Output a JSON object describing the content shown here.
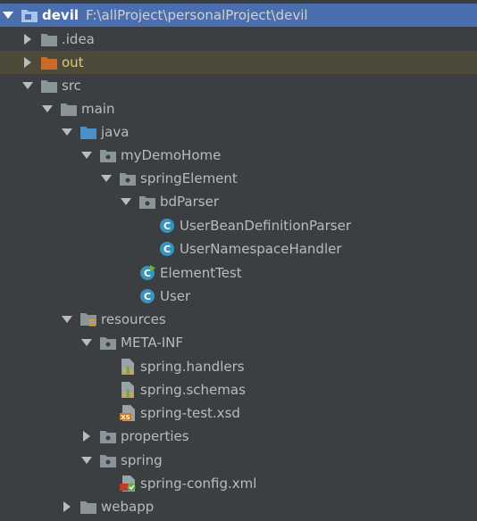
{
  "project": {
    "name": "devil",
    "path": "F:\\allProject\\personalProject\\devil"
  },
  "nodes": {
    "idea": ".idea",
    "out": "out",
    "src": "src",
    "main": "main",
    "java": "java",
    "mydemohome": "myDemoHome",
    "springelement": "springElement",
    "bdparser": "bdParser",
    "userbeandef": "UserBeanDefinitionParser",
    "usernamespace": "UserNamespaceHandler",
    "elementtest": "ElementTest",
    "user": "User",
    "resources": "resources",
    "metainf": "META-INF",
    "handlers": "spring.handlers",
    "schemas": "spring.schemas",
    "xsd": "spring-test.xsd",
    "properties": "properties",
    "spring": "spring",
    "springconfig": "spring-config.xml",
    "webapp": "webapp"
  },
  "colors": {
    "background": "#3c3f41",
    "selection": "#4b6eaf",
    "excluded_row": "#4e4a3a",
    "folder": "#8a9499",
    "source_folder": "#4a90c9",
    "excluded_folder": "#cc6a2a",
    "class_icon": "#3b93bd"
  }
}
